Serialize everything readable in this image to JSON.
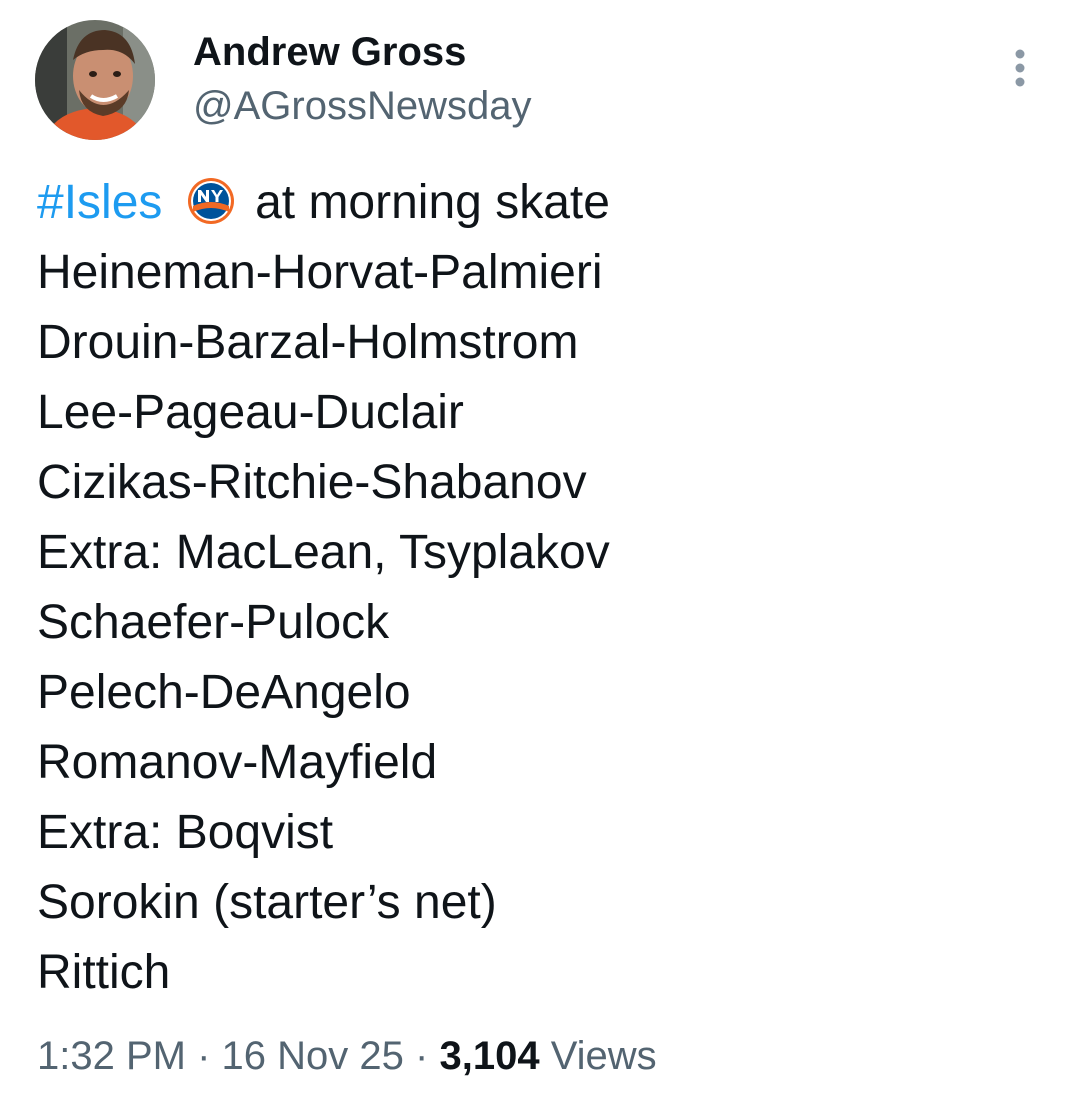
{
  "author": {
    "display_name": "Andrew Gross",
    "handle": "@AGrossNewsday"
  },
  "tweet": {
    "hashtag": "#Isles",
    "emoji": "new-york-islanders-logo",
    "first_line_rest": "at morning skate",
    "lines": [
      "Heineman-Horvat-Palmieri",
      "Drouin-Barzal-Holmstrom",
      "Lee-Pageau-Duclair",
      "Cizikas-Ritchie-Shabanov",
      "Extra: MacLean, Tsyplakov",
      "Schaefer-Pulock",
      "Pelech-DeAngelo",
      "Romanov-Mayfield",
      "Extra: Boqvist",
      "Sorokin (starter’s net)",
      "Rittich"
    ]
  },
  "meta": {
    "time": "1:32 PM",
    "separator": "·",
    "date": "16 Nov 25",
    "views_count": "3,104",
    "views_label": "Views"
  },
  "colors": {
    "link": "#1d9bf0",
    "secondary_text": "#536471",
    "primary_text": "#0f1419"
  }
}
